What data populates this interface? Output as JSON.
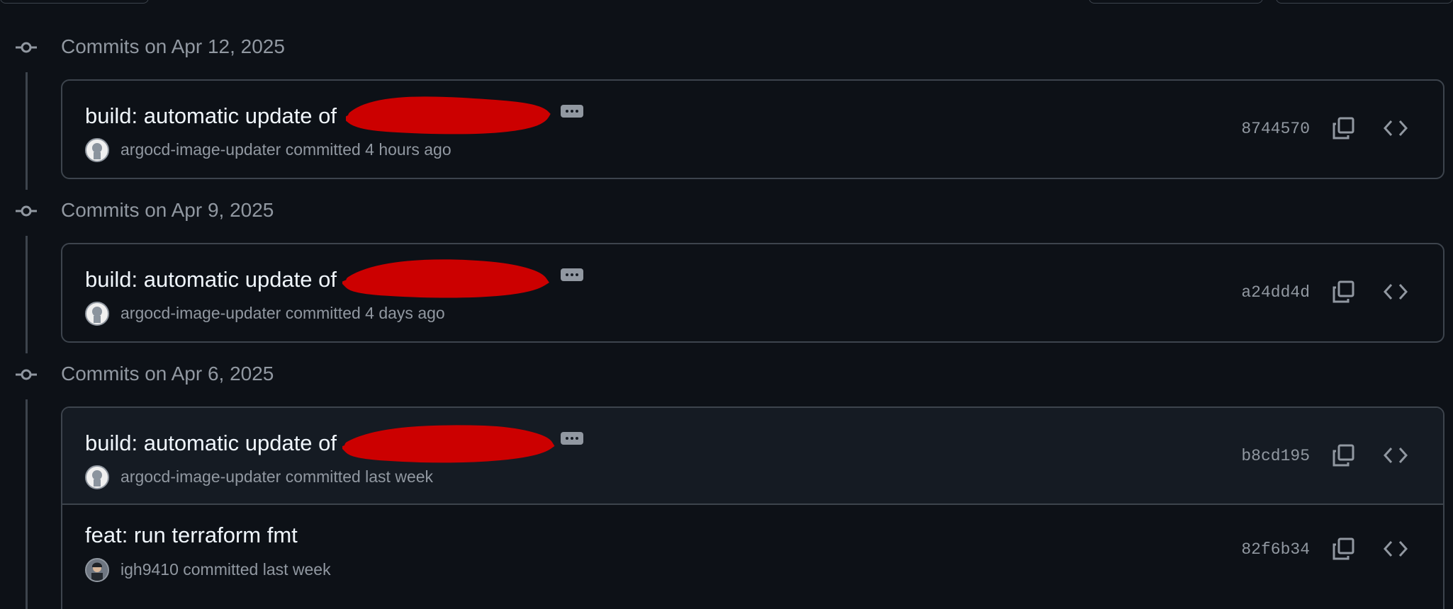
{
  "groups": [
    {
      "heading": "Commits on Apr 12, 2025",
      "commits": [
        {
          "title": "build: automatic update of",
          "author": "argocd-image-updater",
          "committed": "committed 4 hours ago",
          "sha": "8744570",
          "avatar": "github-avatar"
        }
      ]
    },
    {
      "heading": "Commits on Apr 9, 2025",
      "commits": [
        {
          "title": "build: automatic update of",
          "author": "argocd-image-updater",
          "committed": "committed 4 days ago",
          "sha": "a24dd4d",
          "avatar": "github-avatar"
        }
      ]
    },
    {
      "heading": "Commits on Apr 6, 2025",
      "commits": [
        {
          "title": "build: automatic update of",
          "author": "argocd-image-updater",
          "committed": "committed last week",
          "sha": "b8cd195",
          "avatar": "github-avatar"
        },
        {
          "title": "feat: run terraform fmt",
          "author": "igh9410",
          "committed": "committed last week",
          "sha": "82f6b34",
          "avatar": "user-photo-avatar"
        }
      ]
    }
  ],
  "icons": {
    "commit": "git-commit-icon",
    "ellipsis": "ellipsis-icon",
    "copy": "copy-icon",
    "browse": "code-icon"
  },
  "colors": {
    "background": "#0d1117",
    "border": "#3d444d",
    "muted_text": "#9198a1",
    "primary_text": "#f0f6fc",
    "redaction": "#cc0000"
  }
}
